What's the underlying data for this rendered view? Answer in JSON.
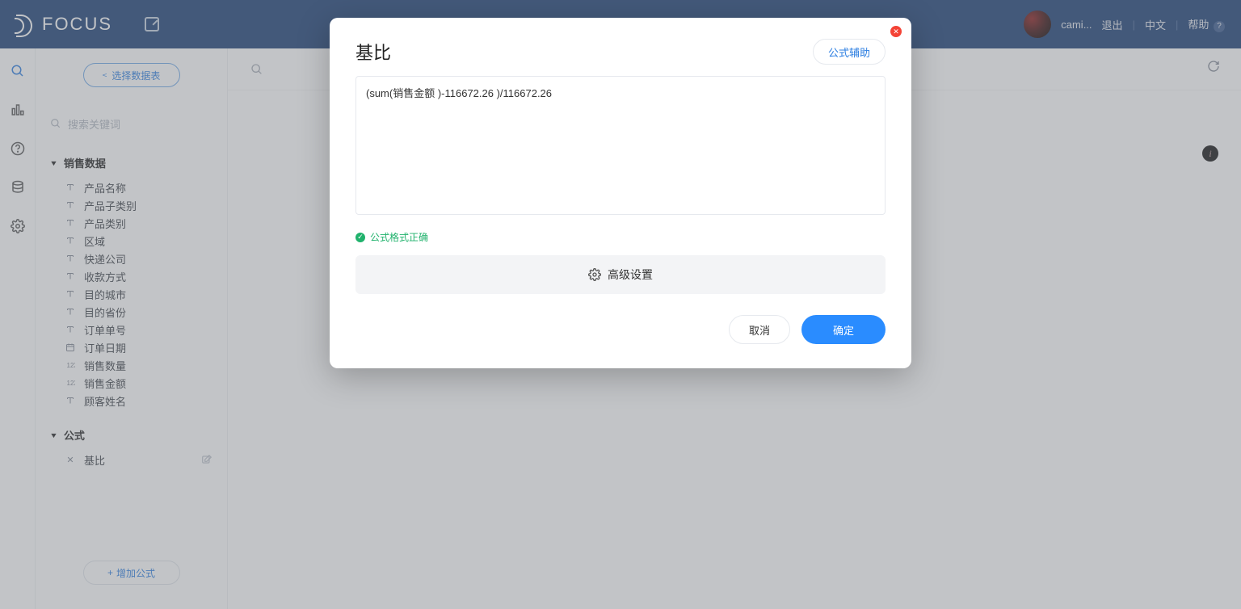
{
  "brand": "FOCUS",
  "topbar": {
    "user": "cami...",
    "logout": "退出",
    "lang": "中文",
    "help": "帮助"
  },
  "sidebar": {
    "select_table": "选择数据表",
    "search_placeholder": "搜索关键词",
    "group_sales": "销售数据",
    "fields": [
      {
        "icon": "T",
        "label": "产品名称"
      },
      {
        "icon": "T",
        "label": "产品子类别"
      },
      {
        "icon": "T",
        "label": "产品类别"
      },
      {
        "icon": "T",
        "label": "区域"
      },
      {
        "icon": "T",
        "label": "快递公司"
      },
      {
        "icon": "T",
        "label": "收款方式"
      },
      {
        "icon": "T",
        "label": "目的城市"
      },
      {
        "icon": "T",
        "label": "目的省份"
      },
      {
        "icon": "T",
        "label": "订单单号"
      },
      {
        "icon": "D",
        "label": "订单日期"
      },
      {
        "icon": "N",
        "label": "销售数量"
      },
      {
        "icon": "N",
        "label": "销售金额"
      },
      {
        "icon": "T",
        "label": "顾客姓名"
      }
    ],
    "group_formula": "公式",
    "formula_item": "基比",
    "add_formula": "增加公式"
  },
  "modal": {
    "title": "基比",
    "assist": "公式辅助",
    "formula": "(sum(销售金额 )-116672.26 )/116672.26",
    "status": "公式格式正确",
    "advanced": "高级设置",
    "cancel": "取消",
    "ok": "确定"
  }
}
